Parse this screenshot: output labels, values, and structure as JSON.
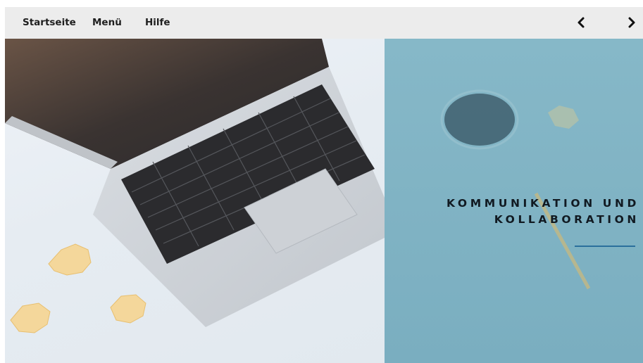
{
  "nav": {
    "items": [
      {
        "label": "Startseite"
      },
      {
        "label": "Menü"
      },
      {
        "label": "Hilfe"
      }
    ],
    "prev_icon": "chevron-left-icon",
    "next_icon": "chevron-right-icon"
  },
  "hero": {
    "title_line1": "KOMMUNIKATION UND",
    "title_line2": "KOLLABORATION",
    "accent_color": "#2b6f9c",
    "panel_color": "#7fb2c3"
  }
}
